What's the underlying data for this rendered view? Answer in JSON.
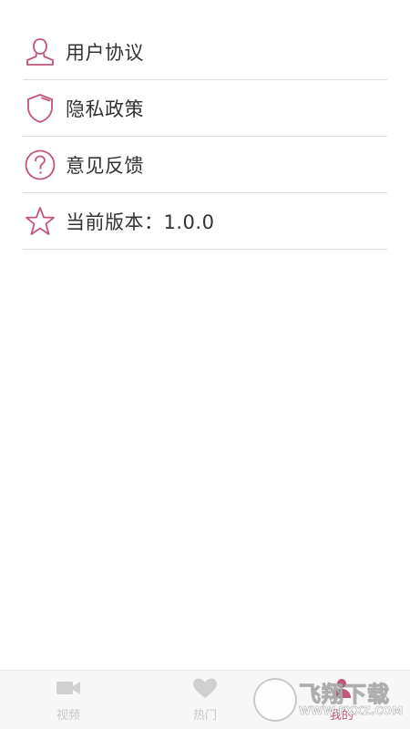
{
  "accent_color": "#c2547e",
  "menu": {
    "items": [
      {
        "icon": "user-icon",
        "label": "用户协议"
      },
      {
        "icon": "shield-icon",
        "label": "隐私政策"
      },
      {
        "icon": "question-icon",
        "label": "意见反馈"
      },
      {
        "icon": "star-icon",
        "label": "当前版本：1.0.0"
      }
    ]
  },
  "tabbar": {
    "tabs": [
      {
        "icon": "video-camera-icon",
        "label": "视频",
        "active": false
      },
      {
        "icon": "heart-icon",
        "label": "热门",
        "active": false
      },
      {
        "icon": "profile-icon",
        "label": "我的",
        "active": true
      }
    ]
  },
  "watermark": {
    "title": "飞翔下载",
    "url": "WWW.FXXZ.COM"
  }
}
